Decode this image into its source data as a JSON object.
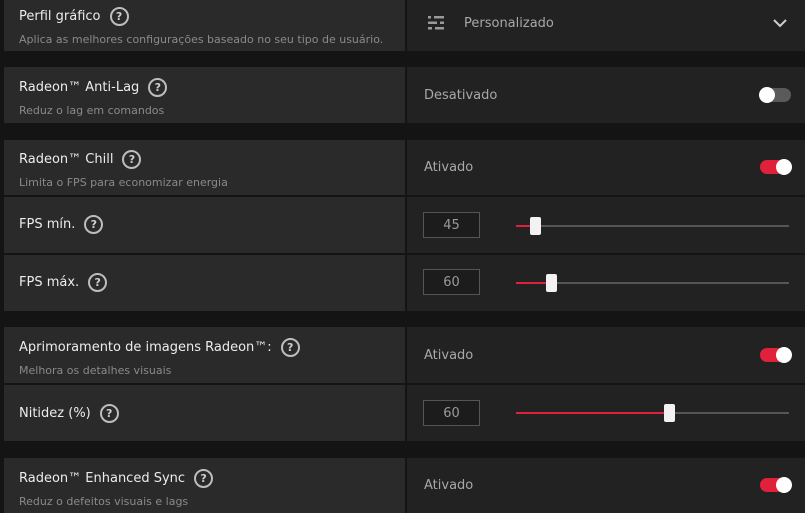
{
  "perfil": {
    "title": "Perfil gráfico",
    "desc": "Aplica as melhores configurações baseado no seu tipo de usuário.",
    "value": "Personalizado"
  },
  "antilag": {
    "title": "Radeon™ Anti-Lag",
    "desc": "Reduz o lag em comandos",
    "status": "Desativado",
    "enabled": false
  },
  "chill": {
    "title": "Radeon™ Chill",
    "desc": "Limita o FPS para economizar energia",
    "status": "Ativado",
    "enabled": true
  },
  "fps_min": {
    "label": "FPS mín.",
    "value": "45",
    "slider_fraction": 0.07
  },
  "fps_max": {
    "label": "FPS máx.",
    "value": "60",
    "slider_fraction": 0.13
  },
  "sharpening": {
    "title": "Aprimoramento de imagens Radeon™:",
    "desc": "Melhora os detalhes visuais",
    "status": "Ativado",
    "enabled": true
  },
  "nitidez": {
    "label": "Nitidez (%)",
    "value": "60",
    "slider_fraction": 0.56
  },
  "enhanced_sync": {
    "title": "Radeon™ Enhanced Sync",
    "desc": "Reduz o defeitos visuais e lags",
    "status": "Ativado",
    "enabled": true
  },
  "help_glyph": "?",
  "colors": {
    "accent": "#e0213a",
    "panel_left": "#2a2a2a",
    "panel_right": "#222222"
  }
}
